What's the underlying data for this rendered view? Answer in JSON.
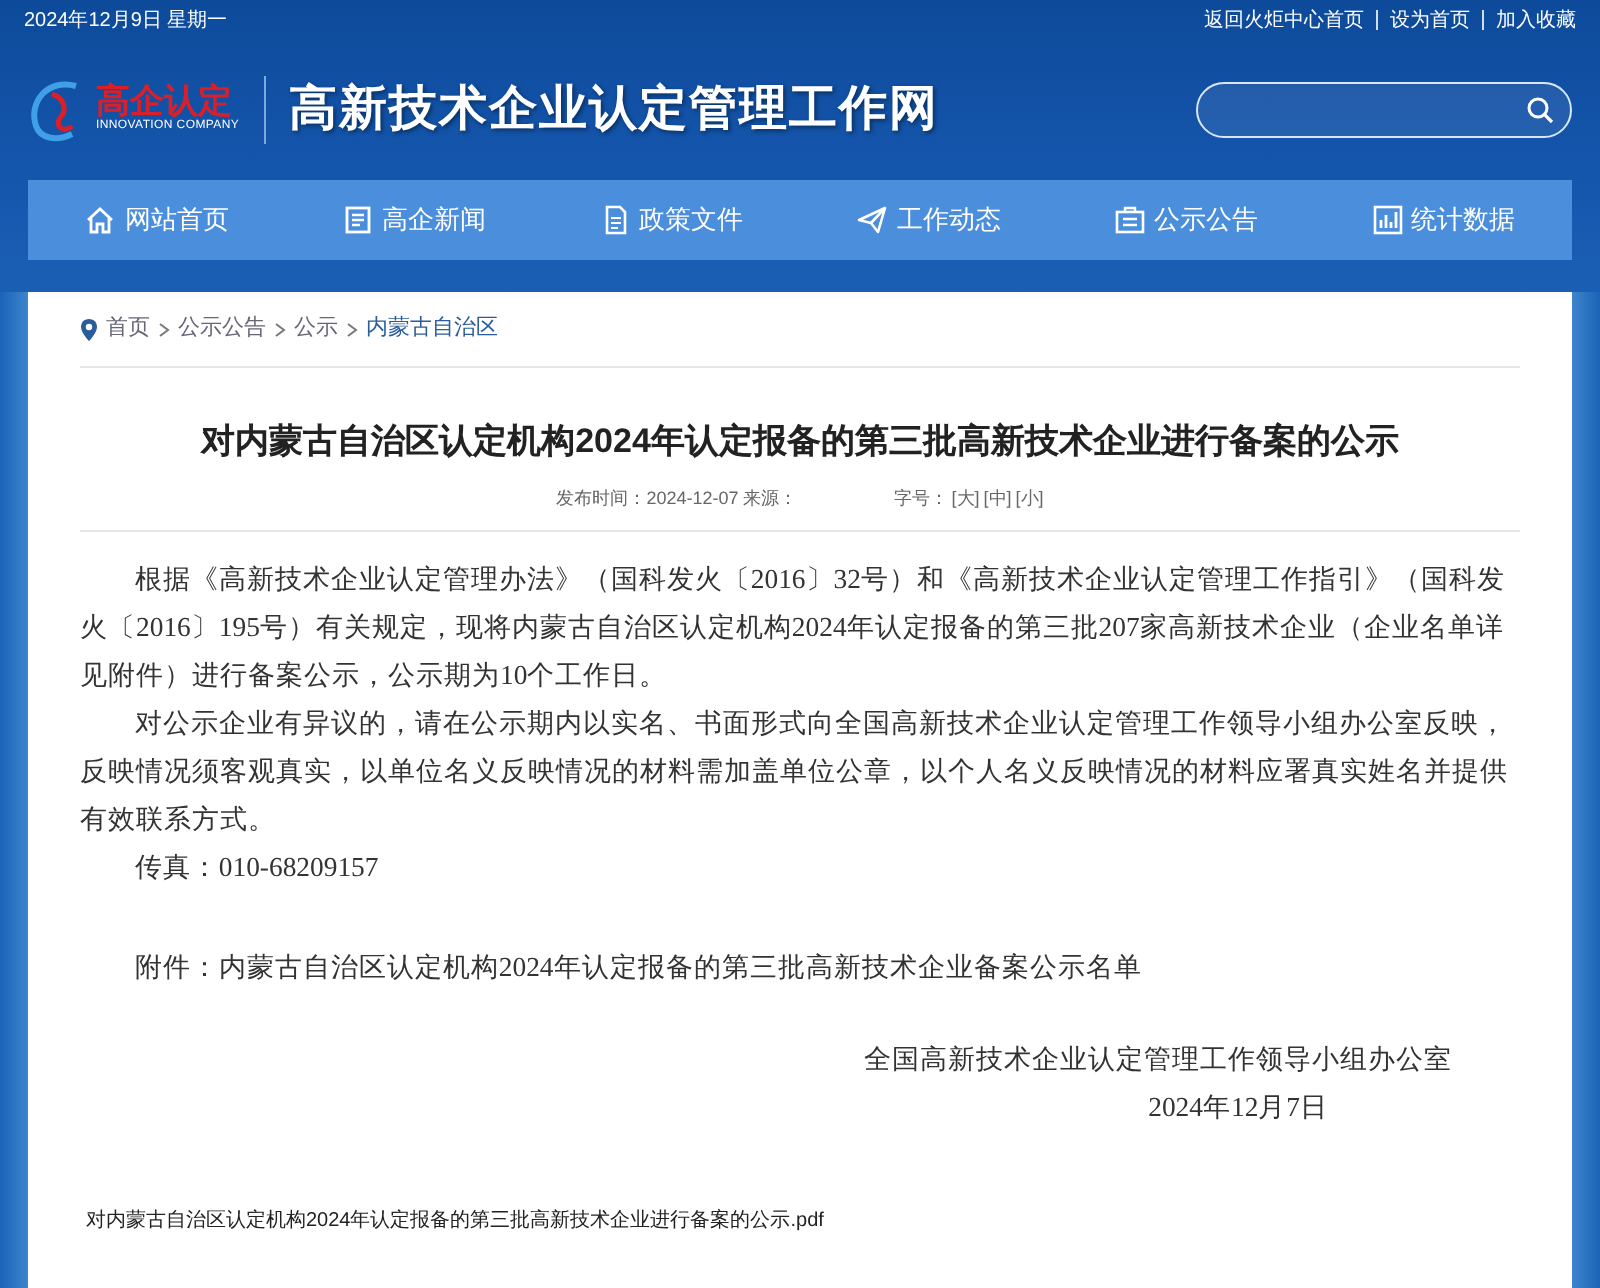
{
  "top_bar": {
    "date": "2024年12月9日 星期一",
    "links": [
      "返回火炬中心首页",
      "设为首页",
      "加入收藏"
    ]
  },
  "logo": {
    "mark_text": "高企认定",
    "subtitle": "INNOVATION COMPANY"
  },
  "site_title": "高新技术企业认定管理工作网",
  "nav": [
    {
      "label": "网站首页",
      "kind": "home"
    },
    {
      "label": "高企新闻",
      "kind": "news"
    },
    {
      "label": "政策文件",
      "kind": "file"
    },
    {
      "label": "工作动态",
      "kind": "plane"
    },
    {
      "label": "公示公告",
      "kind": "board"
    },
    {
      "label": "统计数据",
      "kind": "chart"
    }
  ],
  "breadcrumb": [
    "首页",
    "公示公告",
    "公示",
    "内蒙古自治区"
  ],
  "article": {
    "title": "对内蒙古自治区认定机构2024年认定报备的第三批高新技术企业进行备案的公示",
    "meta": "发布时间：2024-12-07 来源：",
    "font_size_label": "字号：",
    "font_sizes": [
      "[大]",
      "[中]",
      "[小]"
    ],
    "paragraphs": [
      "根据《高新技术企业认定管理办法》（国科发火〔2016〕32号）和《高新技术企业认定管理工作指引》（国科发火〔2016〕195号）有关规定，现将内蒙古自治区认定机构2024年认定报备的第三批207家高新技术企业（企业名单详见附件）进行备案公示，公示期为10个工作日。",
      "对公示企业有异议的，请在公示期内以实名、书面形式向全国高新技术企业认定管理工作领导小组办公室反映，反映情况须客观真实，以单位名义反映情况的材料需加盖单位公章，以个人名义反映情况的材料应署真实姓名并提供有效联系方式。",
      "传真：010-68209157"
    ],
    "attachment": "附件：内蒙古自治区认定机构2024年认定报备的第三批高新技术企业备案公示名单",
    "signature": "全国高新技术企业认定管理工作领导小组办公室",
    "sign_date": "2024年12月7日",
    "file_link": "对内蒙古自治区认定机构2024年认定报备的第三批高新技术企业进行备案的公示.pdf"
  }
}
